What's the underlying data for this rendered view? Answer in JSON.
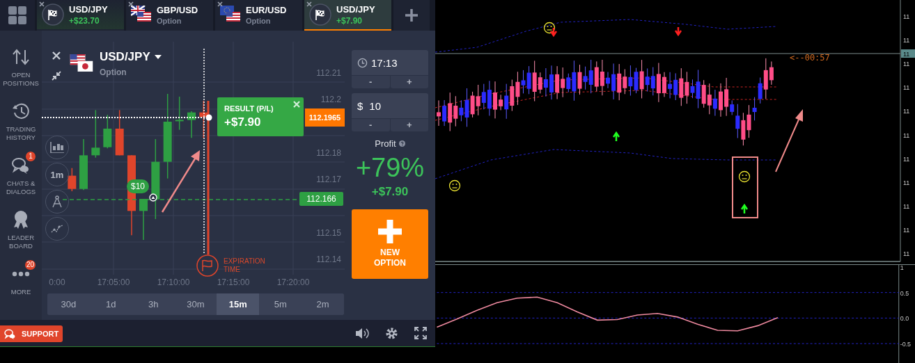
{
  "tabs": [
    {
      "kind": "position",
      "pair": "USD/JPY",
      "subtitle": "+$23.70",
      "selected": false
    },
    {
      "kind": "asset",
      "pair": "GBP/USD",
      "subtitle": "Option",
      "selected": false
    },
    {
      "kind": "asset",
      "pair": "EUR/USD",
      "subtitle": "Option",
      "selected": false
    },
    {
      "kind": "position",
      "pair": "USD/JPY",
      "subtitle": "+$7.90",
      "selected": true
    }
  ],
  "sidebar": [
    {
      "kind": "positions",
      "label": "OPEN POSITIONS"
    },
    {
      "kind": "history",
      "label": "TRADING HISTORY"
    },
    {
      "kind": "chats",
      "label": "CHATS & DIALOGS",
      "badge": "1"
    },
    {
      "kind": "leaderboard",
      "label": "LEADER BOARD"
    },
    {
      "kind": "more",
      "label": "MORE",
      "badge": "20"
    }
  ],
  "chart": {
    "asset": "USD/JPY",
    "asset_type": "Option",
    "interval": "1m",
    "price_labels": [
      "112.21",
      "112.2",
      "112.18",
      "112.17",
      "112.15",
      "112.14"
    ],
    "time_labels": [
      "0:00",
      "17:05:00",
      "17:10:00",
      "17:15:00",
      "17:20:00"
    ],
    "result": {
      "title": "RESULT (P/L)",
      "value": "+$7.90"
    },
    "current_price": "112.1965",
    "strike_price": "112.166",
    "investment": "$10",
    "expiration_label": "EXPIRATION TIME"
  },
  "time_ranges": [
    {
      "label": "30d",
      "selected": false
    },
    {
      "label": "1d",
      "selected": false
    },
    {
      "label": "3h",
      "selected": false
    },
    {
      "label": "30m",
      "selected": false
    },
    {
      "label": "15m",
      "selected": true
    },
    {
      "label": "5m",
      "selected": false
    },
    {
      "label": "2m",
      "selected": false
    }
  ],
  "trade": {
    "expiry": {
      "value": "17:13",
      "minus": "-",
      "plus": "+"
    },
    "amount": {
      "currency": "$",
      "value": "10",
      "minus": "-",
      "plus": "+"
    },
    "profit_label": "Profit",
    "profit_percent": "+79%",
    "profit_amount": "+$7.90",
    "new_option": "NEW OPTION"
  },
  "support": "SUPPORT",
  "terminal": {
    "timer": "<--00:57",
    "current_price_label": "11",
    "price_axis_labels": [
      "11",
      "11",
      "11",
      "11",
      "11",
      "11",
      "11",
      "11",
      "11",
      "11",
      "11"
    ],
    "oscillator": {
      "chart_data": {
        "type": "line",
        "grid": true,
        "ylim": [
          -0.88,
          1.04
        ],
        "yticks": [
          {
            "value": 1,
            "label": "1"
          },
          {
            "value": 0.5,
            "label": "0.5"
          },
          {
            "value": 0,
            "label": "0.0"
          },
          {
            "value": -0.5,
            "label": "-0.5"
          }
        ],
        "series": [
          {
            "color": "#f08aa0",
            "values": [
              -0.18,
              -0.02,
              0.15,
              0.3,
              0.39,
              0.41,
              0.3,
              0.12,
              -0.04,
              -0.03,
              0.06,
              0.09,
              0.02,
              -0.12,
              -0.24,
              -0.25,
              -0.15,
              0.01
            ]
          }
        ]
      }
    }
  }
}
